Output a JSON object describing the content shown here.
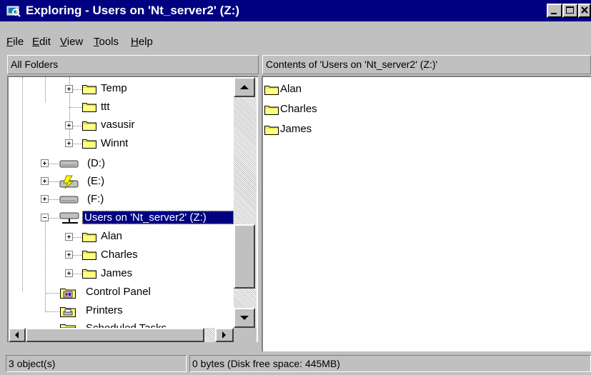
{
  "window": {
    "title": "Exploring - Users on 'Nt_server2' (Z:)"
  },
  "menu": [
    {
      "label": "File",
      "accel": "F",
      "rest": "ile"
    },
    {
      "label": "Edit",
      "accel": "E",
      "rest": "dit"
    },
    {
      "label": "View",
      "accel": "V",
      "rest": "iew"
    },
    {
      "label": "Tools",
      "accel": "T",
      "rest": "ools"
    },
    {
      "label": "Help",
      "accel": "H",
      "rest": "elp"
    }
  ],
  "left_header": "All Folders",
  "right_header": "Contents of 'Users on 'Nt_server2' (Z:)'",
  "tree": {
    "temp": "Temp",
    "ttt": "ttt",
    "vasusir": "vasusir",
    "winnt": "Winnt",
    "d": "(D:)",
    "e": "(E:)",
    "f": "(F:)",
    "z": "Users on 'Nt_server2' (Z:)",
    "alan": "Alan",
    "charles": "Charles",
    "james": "James",
    "control_panel": "Control Panel",
    "printers": "Printers",
    "scheduled_tasks": "Scheduled Tasks"
  },
  "contents": [
    {
      "name": "Alan"
    },
    {
      "name": "Charles"
    },
    {
      "name": "James"
    }
  ],
  "status": {
    "objects": "3 object(s)",
    "info": "0 bytes (Disk free space: 445MB)"
  },
  "colors": {
    "titlebar": "#000080",
    "selection": "#000080",
    "folder": "#ffff80"
  }
}
